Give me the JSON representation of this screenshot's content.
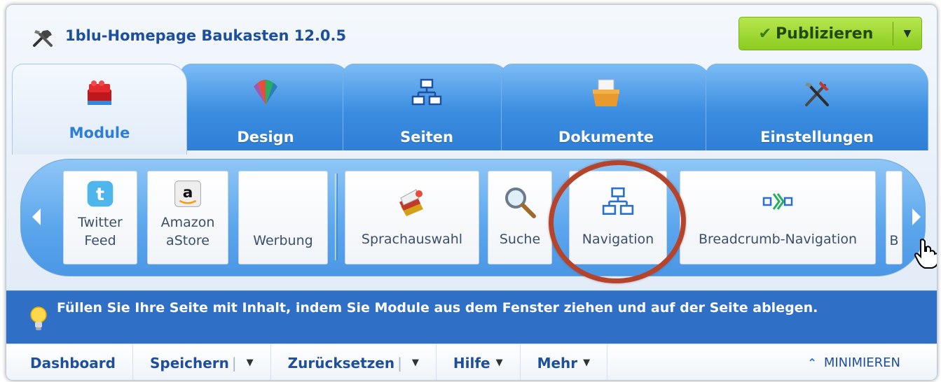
{
  "app": {
    "title": "1blu-Homepage Baukasten 12.0.5"
  },
  "publish": {
    "label": "Publizieren"
  },
  "tabs": [
    {
      "label": "Module",
      "icon": "lego-bricks-icon",
      "active": true
    },
    {
      "label": "Design",
      "icon": "color-palette-icon",
      "active": false
    },
    {
      "label": "Seiten",
      "icon": "sitemap-icon",
      "active": false
    },
    {
      "label": "Dokumente",
      "icon": "file-box-icon",
      "active": false
    },
    {
      "label": "Einstellungen",
      "icon": "tools-icon",
      "active": false
    }
  ],
  "modules": [
    {
      "label": "Twitter\nFeed",
      "icon": "twitter-icon"
    },
    {
      "label": "Amazon\naStore",
      "icon": "amazon-icon"
    },
    {
      "label": "Werbung",
      "icon": ""
    },
    {
      "label": "Sprachauswahl",
      "icon": "language-flags-icon"
    },
    {
      "label": "Suche",
      "icon": "magnifier-icon"
    },
    {
      "label": "Navigation",
      "icon": "sitemap-icon",
      "highlighted": true
    },
    {
      "label": "Breadcrumb-Navigation",
      "icon": "breadcrumb-icon"
    },
    {
      "label": "B",
      "icon": ""
    }
  ],
  "hint": {
    "text": "Füllen Sie Ihre Seite mit Inhalt, indem Sie Module aus dem Fenster ziehen und auf der Seite ablegen."
  },
  "menu": {
    "dashboard": "Dashboard",
    "save": "Speichern",
    "reset": "Zurücksetzen",
    "help": "Hilfe",
    "more": "Mehr",
    "minimize": "MINIMIEREN"
  },
  "colors": {
    "accent": "#2e7dd8",
    "publish_green": "#8ccc1f",
    "highlight_ring": "#b4442c",
    "hint_bar": "#2f6fc6"
  }
}
